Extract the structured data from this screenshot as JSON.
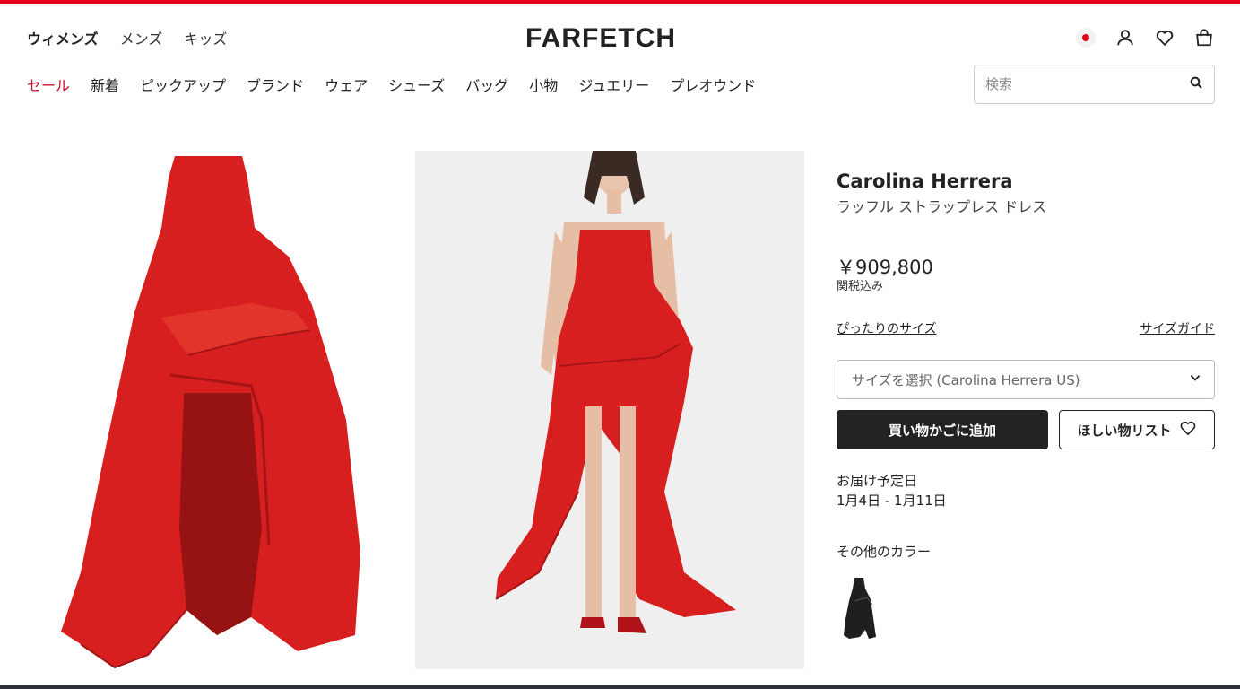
{
  "colors": {
    "accent": "#e2001a",
    "sale": "#c8102e",
    "dark": "#222222",
    "dress": "#d81f1f"
  },
  "nav": {
    "genders": [
      "ウィメンズ",
      "メンズ",
      "キッズ"
    ],
    "categories": [
      "セール",
      "新着",
      "ピックアップ",
      "ブランド",
      "ウェア",
      "シューズ",
      "バッグ",
      "小物",
      "ジュエリー",
      "プレオウンド"
    ]
  },
  "header": {
    "logo": "FARFETCH",
    "icons": [
      "japan-flag-icon",
      "account-icon",
      "heart-icon",
      "bag-icon"
    ]
  },
  "search": {
    "placeholder": "検索",
    "icon": "search-icon"
  },
  "product": {
    "brand": "Carolina Herrera",
    "name": "ラッフル ストラップレス ドレス",
    "price": "￥909,800",
    "tax_note": "関税込み",
    "fit_link": "ぴったりのサイズ",
    "size_guide": "サイズガイド",
    "size_select": "サイズを選択 (Carolina Herrera US)",
    "add_to_cart": "買い物かごに追加",
    "wishlist": "ほしい物リスト",
    "delivery_label": "お届け予定日",
    "delivery_dates": "1月4日 - 1月11日",
    "other_colors_label": "その他のカラー"
  }
}
